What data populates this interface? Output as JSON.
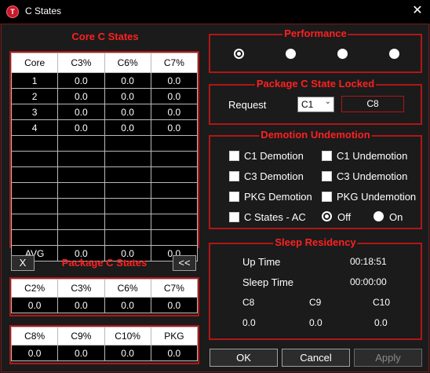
{
  "window": {
    "title": "C States",
    "app_icon_letter": "T",
    "close_glyph": "✕"
  },
  "core": {
    "title": "Core C States",
    "headers": [
      "Core",
      "C3%",
      "C6%",
      "C7%"
    ],
    "rows": [
      [
        "1",
        "0.0",
        "0.0",
        "0.0"
      ],
      [
        "2",
        "0.0",
        "0.0",
        "0.0"
      ],
      [
        "3",
        "0.0",
        "0.0",
        "0.0"
      ],
      [
        "4",
        "0.0",
        "0.0",
        "0.0"
      ],
      [
        "",
        "",
        "",
        ""
      ],
      [
        "",
        "",
        "",
        ""
      ],
      [
        "",
        "",
        "",
        ""
      ],
      [
        "",
        "",
        "",
        ""
      ],
      [
        "",
        "",
        "",
        ""
      ],
      [
        "",
        "",
        "",
        ""
      ],
      [
        "",
        "",
        "",
        ""
      ],
      [
        "AVG",
        "0.0",
        "0.0",
        "0.0"
      ]
    ]
  },
  "x_button": "X",
  "collapse_button": "<<",
  "package": {
    "title": "Package C States",
    "table1": {
      "headers": [
        "C2%",
        "C3%",
        "C6%",
        "C7%"
      ],
      "values": [
        "0.0",
        "0.0",
        "0.0",
        "0.0"
      ]
    },
    "table2": {
      "headers": [
        "C8%",
        "C9%",
        "C10%",
        "PKG"
      ],
      "values": [
        "0.0",
        "0.0",
        "0.0",
        "0.0"
      ]
    }
  },
  "performance": {
    "title": "Performance",
    "selected_index": 0,
    "count": 4
  },
  "locked": {
    "title": "Package C State Locked",
    "request_label": "Request",
    "request_value": "C1",
    "locked_value": "C8"
  },
  "demotion": {
    "title": "Demotion Undemotion",
    "items": [
      {
        "label": "C1 Demotion"
      },
      {
        "label": "C1 Undemotion"
      },
      {
        "label": "C3 Demotion"
      },
      {
        "label": "C3 Undemotion"
      },
      {
        "label": "PKG Demotion"
      },
      {
        "label": "PKG Undemotion"
      },
      {
        "label": "C States - AC"
      }
    ],
    "off_label": "Off",
    "on_label": "On"
  },
  "sleep": {
    "title": "Sleep Residency",
    "up_time_label": "Up Time",
    "up_time_value": "00:18:51",
    "sleep_time_label": "Sleep Time",
    "sleep_time_value": "00:00:00",
    "c8_label": "C8",
    "c9_label": "C9",
    "c10_label": "C10",
    "c8_value": "0.0",
    "c9_value": "0.0",
    "c10_value": "0.0"
  },
  "buttons": {
    "ok": "OK",
    "cancel": "Cancel",
    "apply": "Apply"
  }
}
